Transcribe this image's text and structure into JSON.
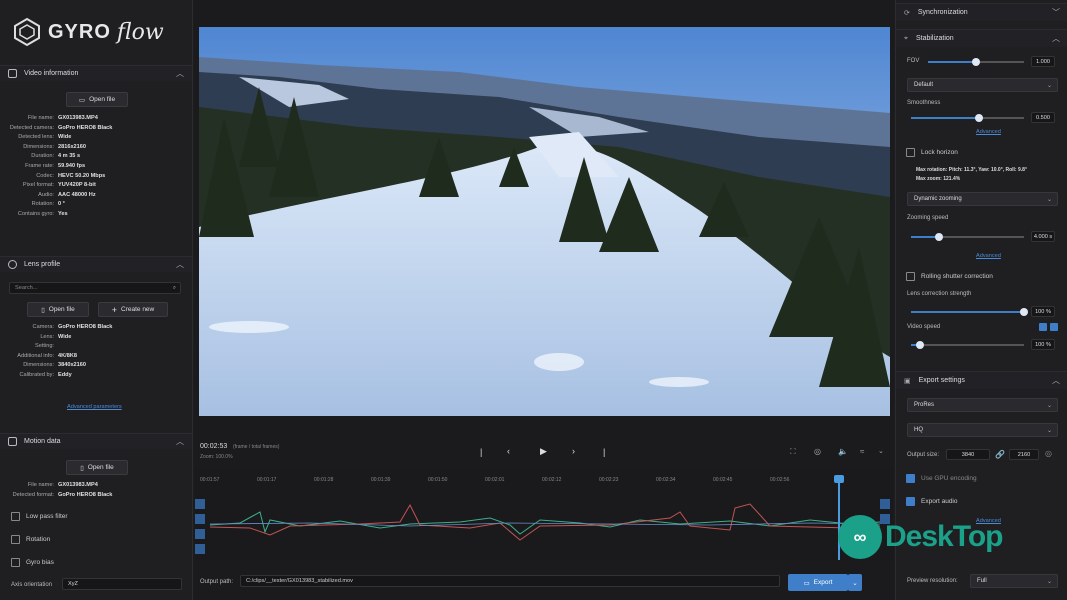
{
  "brand": {
    "gyro": "GYRO",
    "flow": "flow"
  },
  "left": {
    "video_info": {
      "title": "Video information",
      "open_label": "Open file",
      "rows": [
        {
          "k": "File name:",
          "v": "GX013983.MP4"
        },
        {
          "k": "Detected camera:",
          "v": "GoPro HERO8 Black"
        },
        {
          "k": "Detected lens:",
          "v": "Wide"
        },
        {
          "k": "Dimensions:",
          "v": "2816x2160"
        },
        {
          "k": "Duration:",
          "v": "4 m 35 s"
        },
        {
          "k": "Frame rate:",
          "v": "59.940 fps"
        },
        {
          "k": "Codec:",
          "v": "HEVC 50.20 Mbps"
        },
        {
          "k": "Pixel format:",
          "v": "YUV420P 8-bit"
        },
        {
          "k": "Audio:",
          "v": "AAC 48000 Hz"
        },
        {
          "k": "Rotation:",
          "v": "0 °"
        },
        {
          "k": "Contains gyro:",
          "v": "Yes"
        }
      ]
    },
    "lens": {
      "title": "Lens profile",
      "search_placeholder": "Search...",
      "open_label": "Open file",
      "create_label": "Create new",
      "rows": [
        {
          "k": "Camera:",
          "v": "GoPro HERO8 Black"
        },
        {
          "k": "Lens:",
          "v": "Wide"
        },
        {
          "k": "Setting:",
          "v": ""
        },
        {
          "k": "Additional info:",
          "v": "4K/8K8"
        },
        {
          "k": "Dimensions:",
          "v": "3840x2160"
        },
        {
          "k": "Calibrated by:",
          "v": "Eddy"
        }
      ],
      "advanced": "Advanced parameters"
    },
    "motion": {
      "title": "Motion data",
      "open_label": "Open file",
      "rows": [
        {
          "k": "File name:",
          "v": "GX013983.MP4"
        },
        {
          "k": "Detected format:",
          "v": "GoPro HERO8 Black"
        }
      ],
      "low_pass": "Low pass filter",
      "rotation": "Rotation",
      "gyro_bias": "Gyro bias",
      "axis_label": "Axis orientation",
      "axis_value": "XyZ"
    }
  },
  "center": {
    "time": "00:02:53",
    "time_extra": "Zoom: 100.0%",
    "frames": "(frame / total frames)",
    "ticks": [
      "00:01:57",
      "00:01:17",
      "00:01:28",
      "00:01:39",
      "00:01:50",
      "00:02:01",
      "00:02:12",
      "00:02:23",
      "00:02:34",
      "00:02:45",
      "00:02:56"
    ],
    "output_label": "Output path:",
    "output_value": "C:/clips/__tester/GX013983_stabilized.mov",
    "export_label": "Export"
  },
  "right": {
    "sync_title": "Synchronization",
    "stab_title": "Stabilization",
    "fov_label": "FOV",
    "fov_value": "1.000",
    "fov_level": 0.5,
    "method": "Default",
    "smooth_label": "Smoothness",
    "smooth_value": "0.500",
    "smooth_level": 0.6,
    "advanced": "Advanced",
    "lock_horizon": "Lock horizon",
    "max_rotation": "Max rotation: Pitch: 11.3°, Yaw: 10.0°, Roll: 9.8°",
    "max_zoom": "Max zoom: 121.4%",
    "zoom_mode": "Dynamic zooming",
    "zoom_speed_label": "Zooming speed",
    "zoom_speed_value": "4.000 s",
    "zoom_speed_level": 0.25,
    "advanced2": "Advanced",
    "rolling_shutter": "Rolling shutter correction",
    "lens_strength_label": "Lens correction strength",
    "lens_strength_value": "100 %",
    "lens_strength_level": 1.0,
    "video_speed_label": "Video speed",
    "video_speed_value": "100 %",
    "video_speed_level": 0.08,
    "export_title": "Export settings",
    "codec": "ProRes",
    "profile": "HQ",
    "output_size_label": "Output size:",
    "out_w": "3840",
    "out_h": "2160",
    "gpu": "Use GPU encoding",
    "audio": "Export audio",
    "advanced3": "Advanced",
    "preview_res_label": "Preview resolution:",
    "preview_res": "Full"
  },
  "watermark": "DeskTop",
  "colors": {
    "accent": "#3f7fc9",
    "green": "#1ba08a"
  }
}
